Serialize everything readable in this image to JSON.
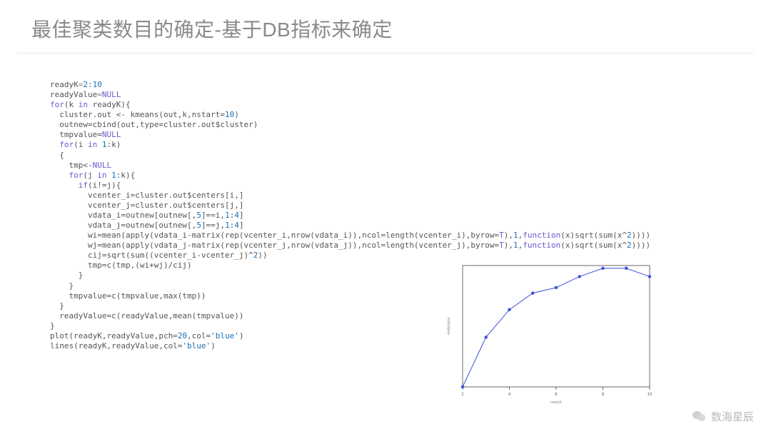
{
  "title": "最佳聚类数目的确定-基于DB指标来确定",
  "code": {
    "l01a": "readyK",
    "l01b": "=",
    "l01c": "2",
    "l01d": ":",
    "l01e": "10",
    "l02a": "readyValue",
    "l02b": "=",
    "l02c": "NULL",
    "l03a": "for",
    "l03b": "(k ",
    "l03c": "in",
    "l03d": " readyK){",
    "l04": "  cluster.out <- kmeans(out,k,nstart=",
    "l04n": "10",
    "l04e": ")",
    "l05": "  outnew=cbind(out,type=cluster.out$cluster)",
    "l06a": "  tmpvalue=",
    "l06b": "NULL",
    "l07a": "  for",
    "l07b": "(i ",
    "l07c": "in",
    "l07d": " ",
    "l07e": "1",
    "l07f": ":k)",
    "l08": "  {",
    "l09a": "    tmp<-",
    "l09b": "NULL",
    "l10a": "    for",
    "l10b": "(j ",
    "l10c": "in",
    "l10d": " ",
    "l10e": "1",
    "l10f": ":k){",
    "l11a": "      if",
    "l11b": "(i!=j){",
    "l12": "        vcenter_i=cluster.out$centers[i,]",
    "l13": "        vcenter_j=cluster.out$centers[j,]",
    "l14a": "        vdata_i=outnew[outnew[,",
    "l14b": "5",
    "l14c": "]==i,",
    "l14d": "1",
    "l14e": ":",
    "l14f": "4",
    "l14g": "]",
    "l15a": "        vdata_j=outnew[outnew[,",
    "l15b": "5",
    "l15c": "]==j,",
    "l15d": "1",
    "l15e": ":",
    "l15f": "4",
    "l15g": "]",
    "l16a": "        wi=mean(apply(vdata_i-matrix(rep(vcenter_i,nrow(vdata_i)),ncol=length(vcenter_i),byrow=",
    "l16b": "T",
    "l16c": "),",
    "l16d": "1",
    "l16e": ",",
    "l16f": "function",
    "l16g": "(x)sqrt(sum(x^",
    "l16h": "2",
    "l16i": "))))",
    "l17a": "        wj=mean(apply(vdata_j-matrix(rep(vcenter_j,nrow(vdata_j)),ncol=length(vcenter_j),byrow=",
    "l17b": "T",
    "l17c": "),",
    "l17d": "1",
    "l17e": ",",
    "l17f": "function",
    "l17g": "(x)sqrt(sum(x^",
    "l17h": "2",
    "l17i": "))))",
    "l18a": "        cij=sqrt(sum((vcenter_i-vcenter_j)^",
    "l18b": "2",
    "l18c": "))",
    "l19": "        tmp=c(tmp,(wi+wj)/cij)",
    "l20": "      }",
    "l21": "    }",
    "l22": "    tmpvalue=c(tmpvalue,max(tmp))",
    "l23": "  }",
    "l24": "  readyValue=c(readyValue,mean(tmpvalue))",
    "l25": "}",
    "l26a": "plot(readyK,readyValue,pch=",
    "l26b": "20",
    "l26c": ",col=",
    "l26d": "'blue'",
    "l26e": ")",
    "l27a": "lines(readyK,readyValue,col=",
    "l27b": "'blue'",
    "l27c": ")"
  },
  "chart_data": {
    "type": "line",
    "x": [
      2,
      3,
      4,
      5,
      6,
      7,
      8,
      9,
      10
    ],
    "y": [
      0.4,
      1.3,
      1.8,
      2.1,
      2.2,
      2.4,
      2.55,
      2.55,
      2.4
    ],
    "xlabel": "readyK",
    "ylabel": "readyValue",
    "xlim": [
      2,
      10
    ],
    "ylim": [
      0.4,
      2.6
    ],
    "xticks": [
      2,
      4,
      6,
      8,
      10
    ],
    "point_color": "#3a4fd8",
    "line_color": "#3a4fd8"
  },
  "watermark": "数海星辰"
}
